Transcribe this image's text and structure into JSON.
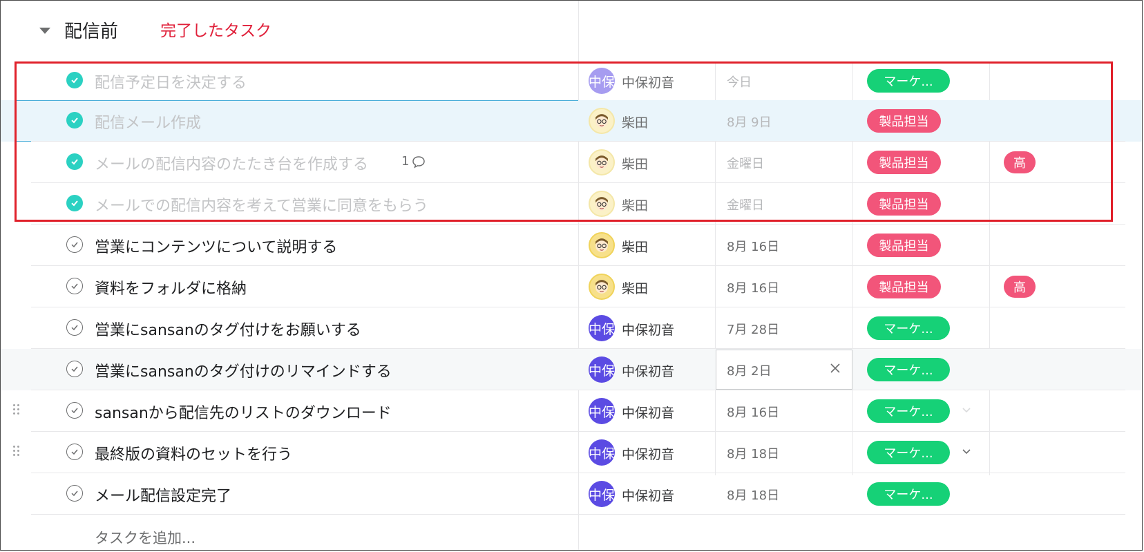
{
  "section": {
    "title": "配信前",
    "note": "完了したタスク"
  },
  "rows": [
    {
      "name": "配信予定日を決定する",
      "comments": "",
      "assignee": "中保初音",
      "avatar_text": "中保",
      "due": "今日",
      "tag": "マーケ...",
      "priority": ""
    },
    {
      "name": "配信メール作成",
      "comments": "",
      "assignee": "柴田",
      "avatar_text": "",
      "due": "8月 9日",
      "tag": "製品担当",
      "priority": ""
    },
    {
      "name": "メールの配信内容のたたき台を作成する",
      "comments": "1",
      "assignee": "柴田",
      "avatar_text": "",
      "due": "金曜日",
      "tag": "製品担当",
      "priority": "高"
    },
    {
      "name": "メールでの配信内容を考えて営業に同意をもらう",
      "comments": "",
      "assignee": "柴田",
      "avatar_text": "",
      "due": "金曜日",
      "tag": "製品担当",
      "priority": ""
    },
    {
      "name": "営業にコンテンツについて説明する",
      "comments": "",
      "assignee": "柴田",
      "avatar_text": "",
      "due": "8月 16日",
      "tag": "製品担当",
      "priority": ""
    },
    {
      "name": "資料をフォルダに格納",
      "comments": "",
      "assignee": "柴田",
      "avatar_text": "",
      "due": "8月 16日",
      "tag": "製品担当",
      "priority": "高"
    },
    {
      "name": "営業にsansanのタグ付けをお願いする",
      "comments": "",
      "assignee": "中保初音",
      "avatar_text": "中保",
      "due": "7月 28日",
      "tag": "マーケ...",
      "priority": ""
    },
    {
      "name": "営業にsansanのタグ付けのリマインドする",
      "comments": "",
      "assignee": "中保初音",
      "avatar_text": "中保",
      "due": "8月 2日",
      "tag": "マーケ...",
      "priority": ""
    },
    {
      "name": "sansanから配信先のリストのダウンロード",
      "comments": "",
      "assignee": "中保初音",
      "avatar_text": "中保",
      "due": "8月 16日",
      "tag": "マーケ...",
      "priority": ""
    },
    {
      "name": "最終版の資料のセットを行う",
      "comments": "",
      "assignee": "中保初音",
      "avatar_text": "中保",
      "due": "8月 18日",
      "tag": "マーケ...",
      "priority": ""
    },
    {
      "name": "メール配信設定完了",
      "comments": "",
      "assignee": "中保初音",
      "avatar_text": "中保",
      "due": "8月 18日",
      "tag": "マーケ...",
      "priority": ""
    }
  ],
  "add_task_label": "タスクを追加...",
  "colors": {
    "completed_check": "#2bd1c2",
    "tag_green": "#16d177",
    "tag_pink": "#f2557a",
    "avatar_purple": "#5b4be3",
    "annotation_red": "#e0202a",
    "selected_row": "#eaf5fb"
  },
  "icons": {
    "expand": "triangle-down-icon",
    "complete": "check-circle-icon",
    "comment": "speech-bubble-icon",
    "clear": "close-icon",
    "dropdown": "chevron-down-icon",
    "drag": "drag-handle-icon"
  }
}
